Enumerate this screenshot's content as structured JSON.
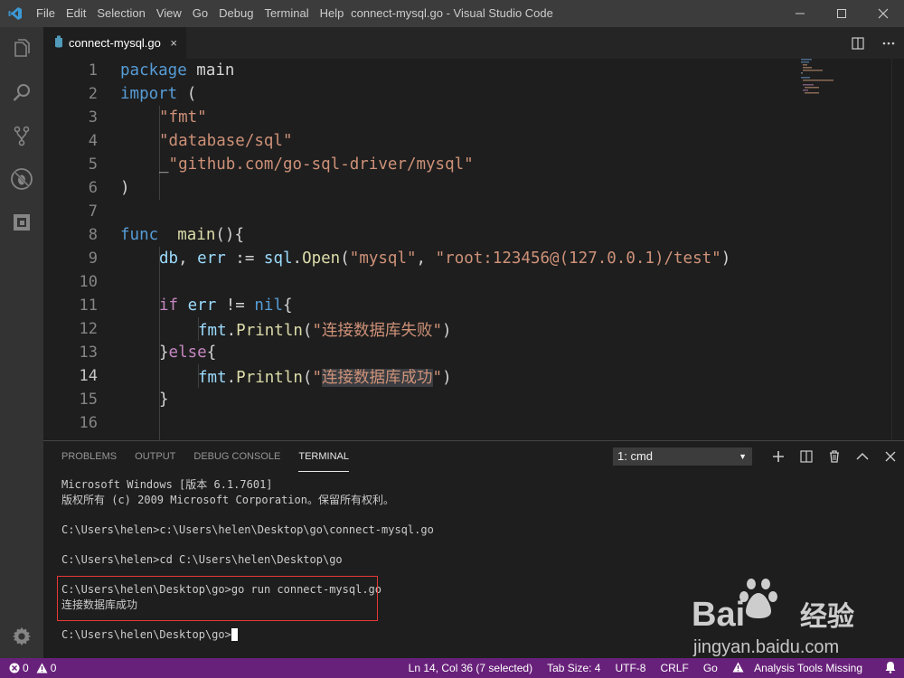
{
  "window": {
    "title": "connect-mysql.go - Visual Studio Code"
  },
  "menu": [
    "File",
    "Edit",
    "Selection",
    "View",
    "Go",
    "Debug",
    "Terminal",
    "Help"
  ],
  "tab": {
    "label": "connect-mysql.go",
    "close": "×"
  },
  "lines": [
    "1",
    "2",
    "3",
    "4",
    "5",
    "6",
    "7",
    "8",
    "9",
    "10",
    "11",
    "12",
    "13",
    "14",
    "15",
    "16"
  ],
  "code": {
    "l1": [
      "package",
      " main"
    ],
    "l2": [
      "import",
      " ("
    ],
    "l3": "\"fmt\"",
    "l4": "\"database/sql\"",
    "l5": [
      "_",
      "\"github.com/go-sql-driver/mysql\""
    ],
    "l6": ")",
    "l8": [
      "func",
      "  ",
      "main",
      "(){"
    ],
    "l9": [
      "db",
      ", ",
      "err",
      " := ",
      "sql",
      ".",
      "Open",
      "(",
      "\"mysql\"",
      ", ",
      "\"root:123456@(127.0.0.1)/test\"",
      ")"
    ],
    "l11": [
      "if",
      " ",
      "err",
      " != ",
      "nil",
      "{"
    ],
    "l12": [
      "fmt",
      ".",
      "Println",
      "(",
      "\"连接数据库失败\"",
      ")"
    ],
    "l13": [
      "}",
      "else",
      "{"
    ],
    "l14": [
      "fmt",
      ".",
      "Println",
      "(",
      "\"",
      "连接数据库成功",
      "\"",
      ")"
    ],
    "l15": "}"
  },
  "panel": {
    "tabs": [
      "PROBLEMS",
      "OUTPUT",
      "DEBUG CONSOLE",
      "TERMINAL"
    ],
    "terminal_select": "1: cmd",
    "terminal_lines": [
      "Microsoft Windows [版本 6.1.7601]",
      "版权所有 (c) 2009 Microsoft Corporation。保留所有权利。",
      "",
      "C:\\Users\\helen>c:\\Users\\helen\\Desktop\\go\\connect-mysql.go",
      "",
      "C:\\Users\\helen>cd C:\\Users\\helen\\Desktop\\go",
      "",
      "C:\\Users\\helen\\Desktop\\go>go run connect-mysql.go",
      "连接数据库成功",
      "",
      "C:\\Users\\helen\\Desktop\\go>"
    ]
  },
  "status": {
    "errors": "0",
    "warnings": "0",
    "position": "Ln 14, Col 36 (7 selected)",
    "tab_size": "Tab Size: 4",
    "encoding": "UTF-8",
    "eol": "CRLF",
    "language": "Go",
    "analysis": "Analysis Tools Missing"
  },
  "watermark": {
    "brand": "Bai",
    "cn": "经验",
    "url": "jingyan.baidu.com"
  },
  "colors": {
    "statusbar": "#68217a",
    "keyword": "#569cd6",
    "string": "#ce9178",
    "control": "#c586c0",
    "function": "#dcdcaa",
    "variable": "#9cdcfe"
  }
}
